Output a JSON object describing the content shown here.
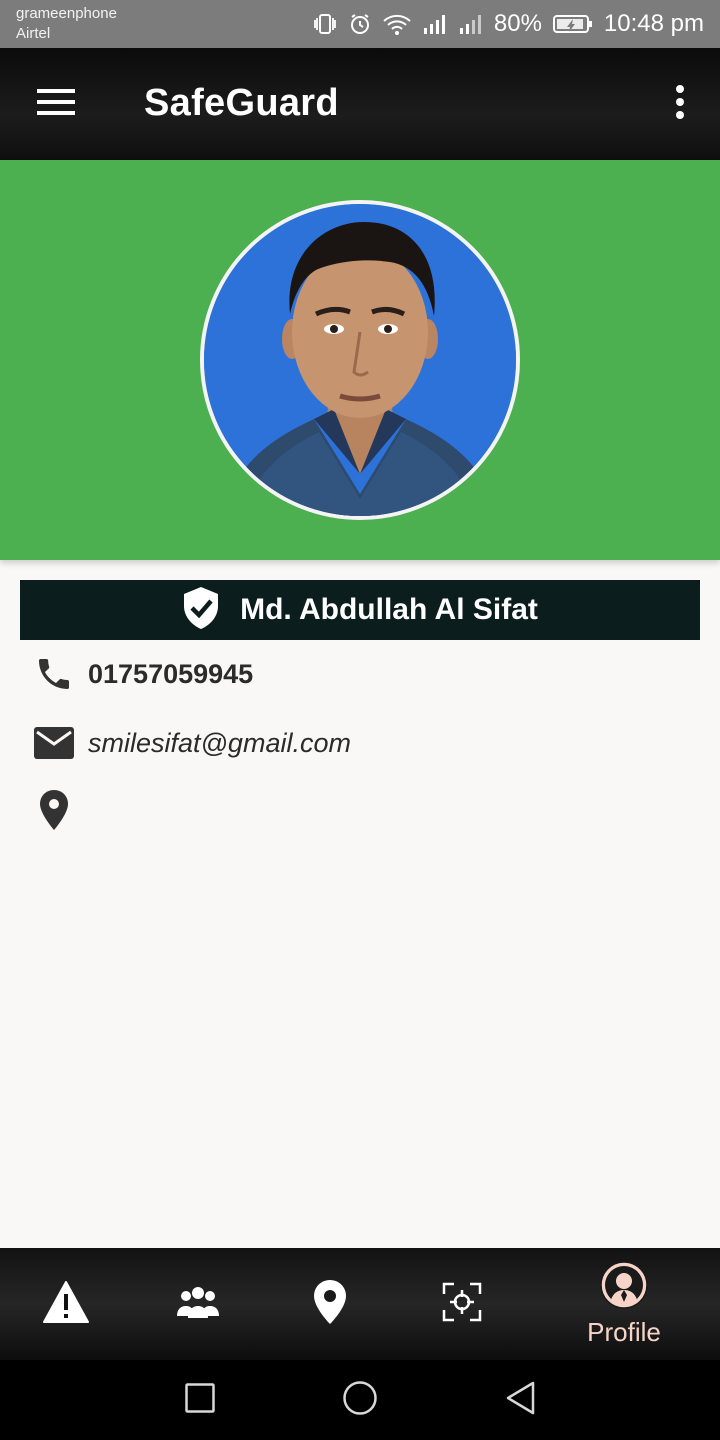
{
  "status_bar": {
    "carrier_1": "grameenphone",
    "carrier_2": "Airtel",
    "battery": "80%",
    "time": "10:48 pm",
    "icons": [
      "vibrate-icon",
      "alarm-icon",
      "wifi-icon",
      "signal-icon",
      "signal-icon",
      "battery-icon"
    ]
  },
  "app_bar": {
    "title": "SafeGuard",
    "menu_icon": "menu-icon",
    "overflow_icon": "more-vertical-icon"
  },
  "profile": {
    "name": "Md. Abdullah Al Sifat",
    "phone": "01757059945",
    "email": "smilesifat@gmail.com",
    "location": ""
  },
  "bottom_nav": {
    "items": [
      {
        "icon": "warning-icon"
      },
      {
        "icon": "group-icon"
      },
      {
        "icon": "location-pin-icon"
      },
      {
        "icon": "scan-target-icon"
      },
      {
        "icon": "profile-avatar-icon",
        "label": "Profile",
        "active": true
      }
    ]
  },
  "system_nav": {
    "icons": [
      "recent-apps-icon",
      "home-icon",
      "back-icon"
    ]
  },
  "colors": {
    "header_green": "#4caf50",
    "name_banner": "#0b1d1d",
    "avatar_bg": "#2d72d9",
    "active_label": "#f6d5c8"
  }
}
